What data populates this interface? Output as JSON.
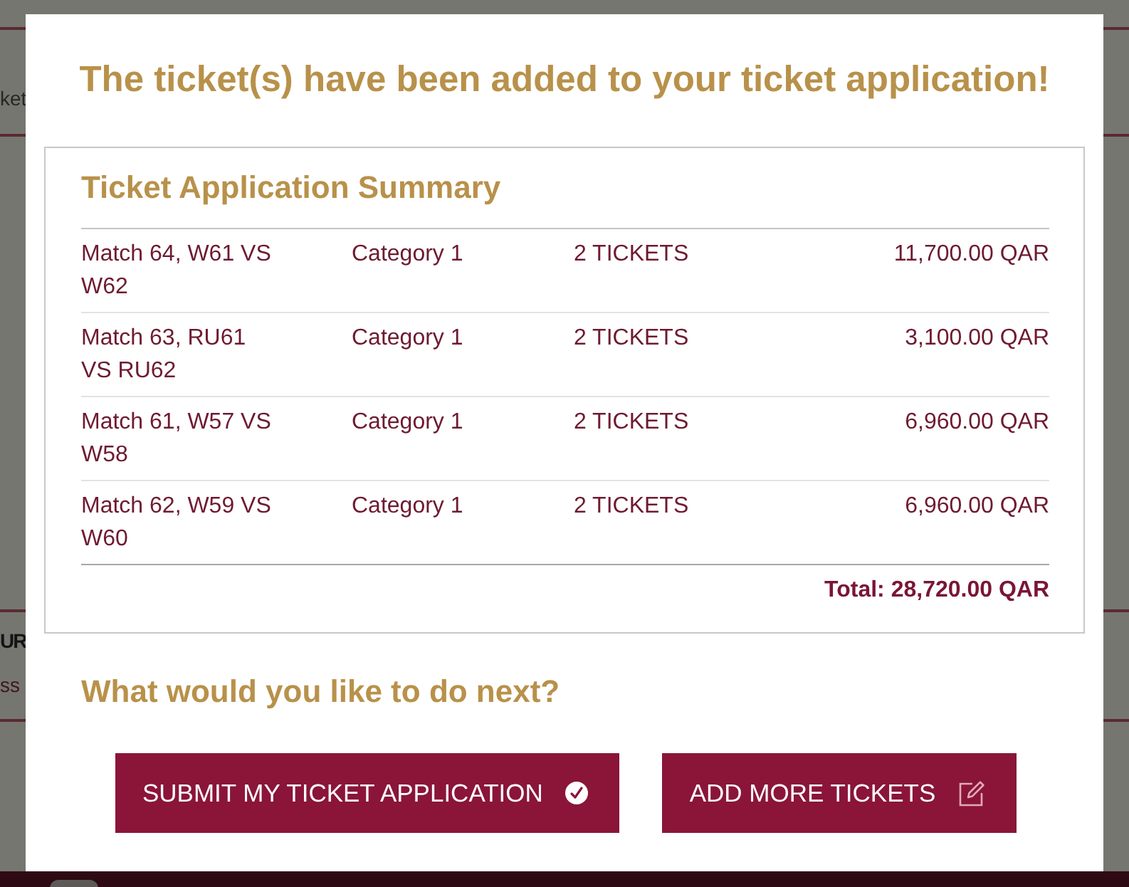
{
  "background_page": {
    "nav_item_fragment": "ket",
    "section_title_fragment": "UR",
    "section_text_fragment": "ss"
  },
  "modal": {
    "title": "The ticket(s) have been added to your ticket application!",
    "summary": {
      "heading": "Ticket Application Summary",
      "rows": [
        {
          "match": "Match 64, W61 VS W62",
          "category": "Category 1",
          "quantity": "2 TICKETS",
          "price": "11,700.00 QAR"
        },
        {
          "match": "Match 63, RU61 VS RU62",
          "category": "Category 1",
          "quantity": "2 TICKETS",
          "price": "3,100.00 QAR"
        },
        {
          "match": "Match 61, W57 VS W58",
          "category": "Category 1",
          "quantity": "2 TICKETS",
          "price": "6,960.00 QAR"
        },
        {
          "match": "Match 62, W59 VS W60",
          "category": "Category 1",
          "quantity": "2 TICKETS",
          "price": "6,960.00 QAR"
        }
      ],
      "total": "Total: 28,720.00 QAR"
    },
    "next_heading": "What would you like to do next?",
    "buttons": [
      {
        "label": "SUBMIT MY TICKET APPLICATION",
        "kind": "submit"
      },
      {
        "label": "ADD MORE TICKETS",
        "kind": "add"
      }
    ]
  }
}
